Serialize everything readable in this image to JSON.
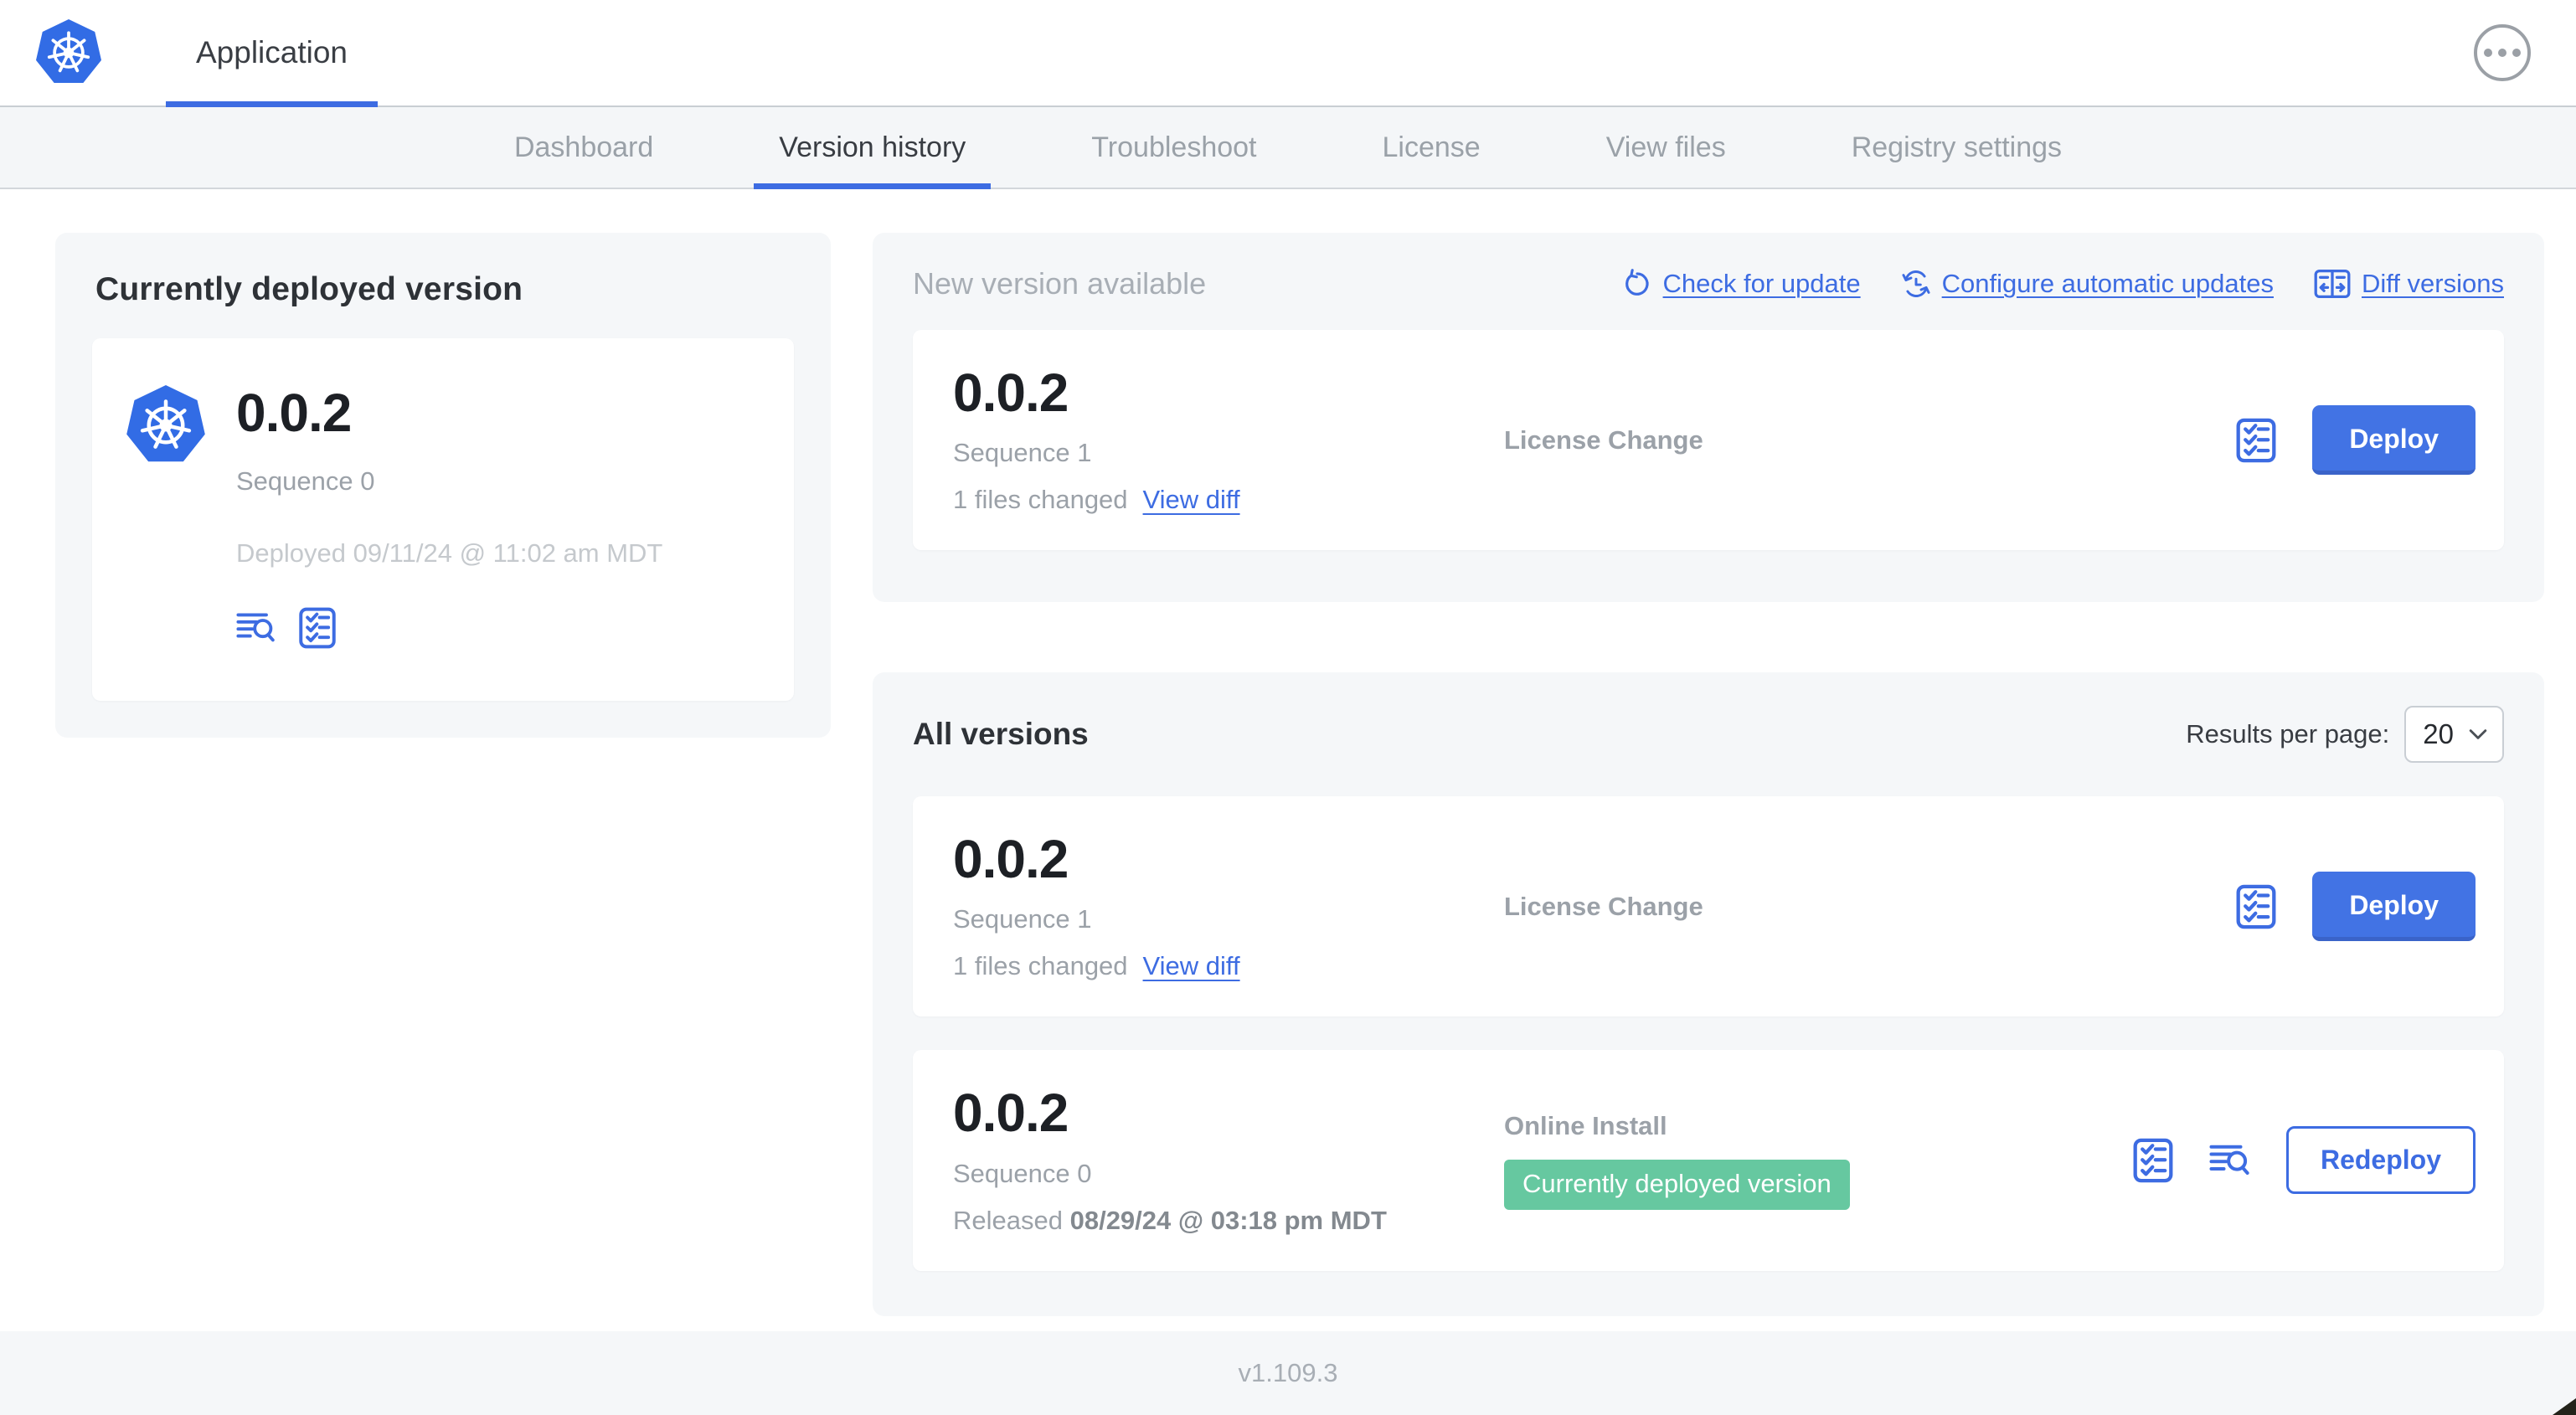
{
  "header": {
    "app_tab_label": "Application"
  },
  "nav": {
    "tabs": [
      {
        "label": "Dashboard",
        "active": false
      },
      {
        "label": "Version history",
        "active": true
      },
      {
        "label": "Troubleshoot",
        "active": false
      },
      {
        "label": "License",
        "active": false
      },
      {
        "label": "View files",
        "active": false
      },
      {
        "label": "Registry settings",
        "active": false
      }
    ]
  },
  "current_version": {
    "title": "Currently deployed version",
    "version": "0.0.2",
    "sequence": "Sequence 0",
    "deployed": "Deployed 09/11/24 @ 11:02 am MDT",
    "icons": [
      "deploy-logs-icon",
      "config-checklist-icon"
    ]
  },
  "new_version": {
    "title": "New version available",
    "links": {
      "check": "Check for update",
      "configure": "Configure automatic updates",
      "diff": "Diff versions"
    },
    "row": {
      "version": "0.0.2",
      "sequence": "Sequence 1",
      "files_changed": "1 files changed",
      "view_diff": "View diff",
      "status": "License Change",
      "button": "Deploy"
    }
  },
  "all_versions": {
    "title": "All versions",
    "results_per_page_label": "Results per page:",
    "results_per_page_value": "20",
    "rows": [
      {
        "version": "0.0.2",
        "sequence": "Sequence 1",
        "files_changed": "1 files changed",
        "view_diff": "View diff",
        "status": "License Change",
        "button": "Deploy"
      },
      {
        "version": "0.0.2",
        "sequence": "Sequence 0",
        "released_prefix": "Released ",
        "released_date": "08/29/24 @ 03:18 pm MDT",
        "status": "Online Install",
        "badge": "Currently deployed version",
        "button": "Redeploy"
      }
    ]
  },
  "footer": {
    "version": "v1.109.3"
  },
  "colors": {
    "primary_blue": "#3d6ce2",
    "button_blue": "#4273e4",
    "badge_green": "#66c8a0",
    "kubernetes_blue": "#326ce5"
  }
}
